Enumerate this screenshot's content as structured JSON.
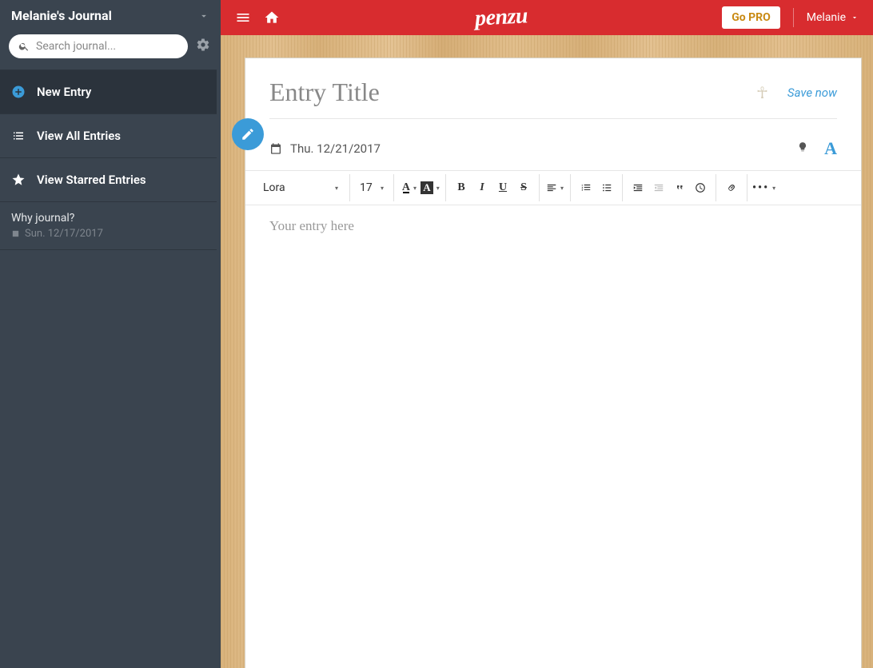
{
  "sidebar": {
    "title": "Melanie's Journal",
    "search_placeholder": "Search journal...",
    "new_entry": "New Entry",
    "view_all": "View All Entries",
    "view_starred": "View Starred Entries",
    "entries": [
      {
        "title": "Why journal?",
        "date": "Sun. 12/17/2017"
      }
    ]
  },
  "topbar": {
    "logo": "penzu",
    "go_pro": "Go PRO",
    "user": "Melanie"
  },
  "editor": {
    "title_placeholder": "Entry Title",
    "save_now": "Save now",
    "date": "Thu. 12/21/2017",
    "body_placeholder": "Your entry here",
    "toolbar": {
      "font": "Lora",
      "size": "17"
    }
  },
  "colors": {
    "accent": "#3b9bd8",
    "header": "#d82c2f",
    "sidebar": "#3a444f"
  }
}
